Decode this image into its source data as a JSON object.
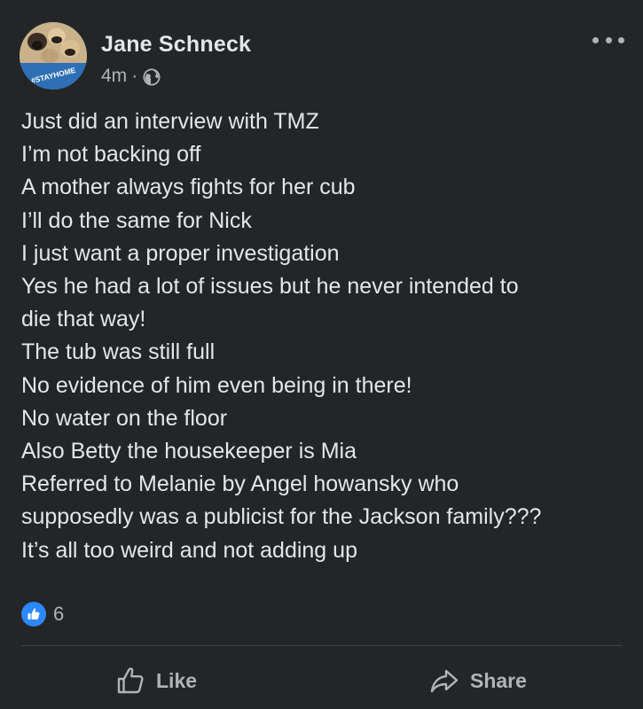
{
  "post": {
    "author": "Jane Schneck",
    "time": "4m",
    "separator": "·",
    "privacy_icon": "globe-icon",
    "avatar_badge_text": "#STAYHOME",
    "lines": [
      "Just did an interview with TMZ",
      "I’m not backing off",
      "A mother always fights for her cub",
      "I’ll do the same for Nick",
      "I just want a proper investigation",
      "Yes he had a lot of issues but he never intended to",
      "die that way!",
      "The tub was still full",
      "No evidence of him even being in there!",
      "No water on the floor",
      "Also Betty the housekeeper is Mia",
      "Referred to Melanie by Angel howansky who",
      "supposedly was a publicist for the Jackson family???",
      "It’s all too weird and not adding up"
    ]
  },
  "reactions": {
    "icon": "like-icon",
    "count": "6"
  },
  "actions": {
    "like_label": "Like",
    "share_label": "Share"
  },
  "colors": {
    "background": "#242526",
    "text_primary": "#e4e6eb",
    "text_secondary": "#b0b3b8",
    "like_blue": "#2d88ff",
    "divider": "#3e4042"
  }
}
